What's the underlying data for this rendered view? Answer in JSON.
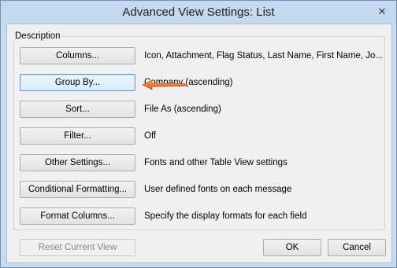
{
  "window": {
    "title": "Advanced View Settings: List",
    "close_glyph": "✕"
  },
  "description_label": "Description",
  "rows": [
    {
      "button": "Columns...",
      "value": "Icon, Attachment, Flag Status, Last Name, First Name, Jo..."
    },
    {
      "button": "Group By...",
      "value": "Company (ascending)"
    },
    {
      "button": "Sort...",
      "value": "File As (ascending)"
    },
    {
      "button": "Filter...",
      "value": "Off"
    },
    {
      "button": "Other Settings...",
      "value": "Fonts and other Table View settings"
    },
    {
      "button": "Conditional Formatting...",
      "value": "User defined fonts on each message"
    },
    {
      "button": "Format Columns...",
      "value": "Specify the display formats for each field"
    }
  ],
  "footer": {
    "reset_label": "Reset Current View",
    "ok_label": "OK",
    "cancel_label": "Cancel"
  },
  "colors": {
    "arrow": "#e8742b",
    "focus_border": "#5c9bd6"
  }
}
